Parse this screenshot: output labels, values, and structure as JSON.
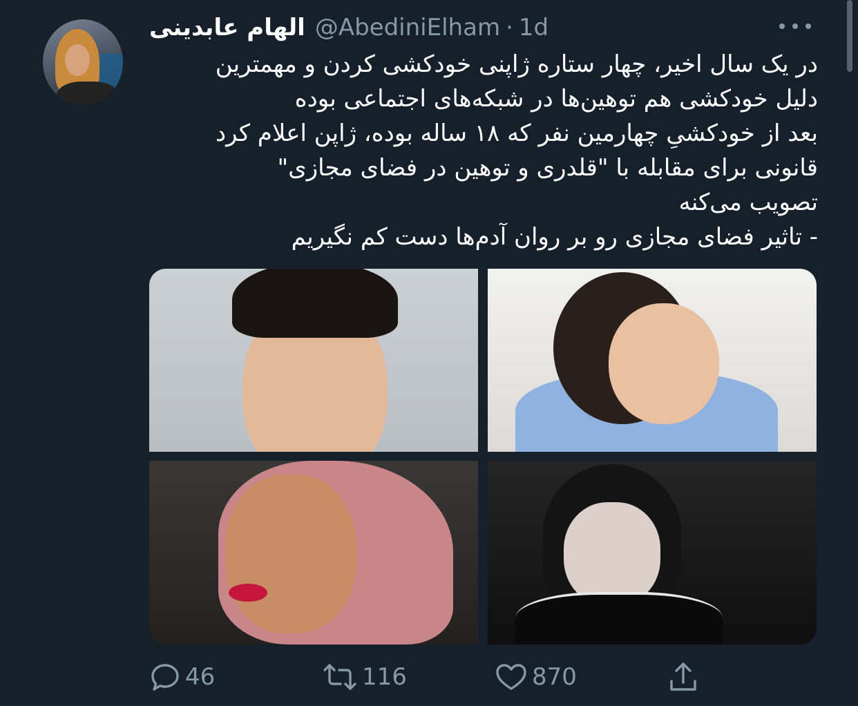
{
  "tweet": {
    "author_name": "الهام عابدینی",
    "handle": "@AbediniElham",
    "separator": "·",
    "time": "1d",
    "lines": [
      "در  یک سال اخیر، چهار ستاره ژاپنی خودکشی کردن و مهمترین",
      "دلیل خودکشی هم توهین‌ها در شبکه‌های اجتماعی بوده",
      "بعد از خودکشیِ چهارمین نفر که ۱۸ ساله بوده، ژاپن اعلام کرد",
      "قانونی برای مقابله با \"قلدری و توهین در فضای مجازی\"",
      "تصویب می‌کنه",
      "- تاثیر فضای مجازی رو بر روان آدم‌ها دست کم نگیریم"
    ],
    "actions": {
      "replies": "46",
      "retweets": "116",
      "likes": "870"
    }
  },
  "colors": {
    "background": "#15202b",
    "text": "#ffffff",
    "secondary": "#8899a6"
  },
  "icons": [
    "more-icon",
    "reply-icon",
    "retweet-icon",
    "like-icon",
    "share-icon"
  ]
}
